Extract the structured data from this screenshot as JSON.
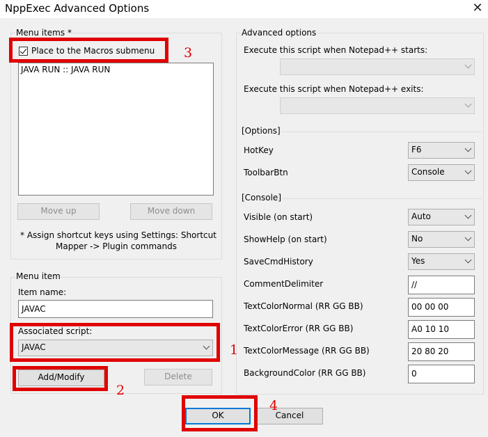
{
  "window": {
    "title": "NppExec Advanced Options"
  },
  "menu_items_group": {
    "title": "Menu items *",
    "checkbox_label": "Place to the Macros submenu",
    "checkbox_checked": true,
    "list": [
      "JAVA RUN :: JAVA RUN"
    ],
    "move_up": "Move up",
    "move_down": "Move down",
    "note_line1": "* Assign shortcut keys using Settings:  Shortcut",
    "note_line2": "Mapper -> Plugin commands"
  },
  "menu_item_group": {
    "title": "Menu item",
    "item_name_label": "Item name:",
    "item_name_value": "JAVAC",
    "associated_script_label": "Associated script:",
    "associated_script_value": "JAVAC",
    "add_modify": "Add/Modify",
    "delete": "Delete"
  },
  "advanced_group": {
    "title": "Advanced options",
    "start_label": "Execute this script when Notepad++ starts:",
    "start_value": "",
    "exit_label": "Execute this script when Notepad++ exits:",
    "exit_value": "",
    "options_title": "[Options]",
    "hotkey_label": "HotKey",
    "hotkey_value": "F6",
    "toolbar_label": "ToolbarBtn",
    "toolbar_value": "Console",
    "console_title": "[Console]",
    "visible_label": "Visible (on start)",
    "visible_value": "Auto",
    "showhelp_label": "ShowHelp (on start)",
    "showhelp_value": "No",
    "savecmd_label": "SaveCmdHistory",
    "savecmd_value": "Yes",
    "comment_label": "CommentDelimiter",
    "comment_value": "//",
    "tc_normal_label": "TextColorNormal (RR GG BB)",
    "tc_normal_value": "00 00 00",
    "tc_error_label": "TextColorError (RR GG BB)",
    "tc_error_value": "A0 10 10",
    "tc_message_label": "TextColorMessage (RR GG BB)",
    "tc_message_value": "20 80 20",
    "bg_label": "BackgroundColor (RR GG BB)",
    "bg_value": "0"
  },
  "footer": {
    "ok": "OK",
    "cancel": "Cancel"
  },
  "annotations": {
    "n1": "1",
    "n2": "2",
    "n3": "3",
    "n4": "4",
    "color": "#e00000"
  }
}
